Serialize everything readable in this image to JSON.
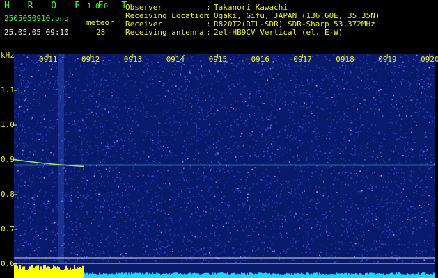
{
  "app": {
    "name": "H R O F F T",
    "version": "1.0.0"
  },
  "file": {
    "name": "2505050910.png",
    "datetime": "25.05.05 09:10"
  },
  "meteor": {
    "label": "meteor",
    "count": "28"
  },
  "info": [
    {
      "key": "Observer",
      "sep": ":",
      "value": "Takanori Kawachi"
    },
    {
      "key": "Receiving Location",
      "sep": ":",
      "value": "Ogaki, Gifu, JAPAN (136.60E, 35.35N)"
    },
    {
      "key": "Receiver",
      "sep": ":",
      "value": "R820T2(RTL-SDR) SDR-Sharp 53.372MHz"
    },
    {
      "key": "Receiving antenna",
      "sep": ":",
      "value": "2el-HB9CV Vertical (el. E-W)"
    }
  ],
  "chart_data": {
    "type": "heatmap",
    "ylabel": "kHz",
    "yticks": [
      "1.1",
      "1.0",
      "0.9",
      "0.8",
      "0.7",
      "0.6"
    ],
    "yvalues": [
      1.1,
      1.0,
      0.9,
      0.8,
      0.7,
      0.6
    ],
    "ylim": [
      0.59,
      1.2
    ],
    "time_labels": [
      "0911",
      "0912",
      "0913",
      "0914",
      "0915",
      "0916",
      "0917",
      "0918",
      "0919",
      "0920"
    ],
    "carrier_khz": 0.885,
    "colors": {
      "background": "#0a1a6a",
      "noise": "#3050ff",
      "carrier": "#40e0e0",
      "bottom_bar": "#18d8ff",
      "peak": "#ffff00"
    }
  }
}
